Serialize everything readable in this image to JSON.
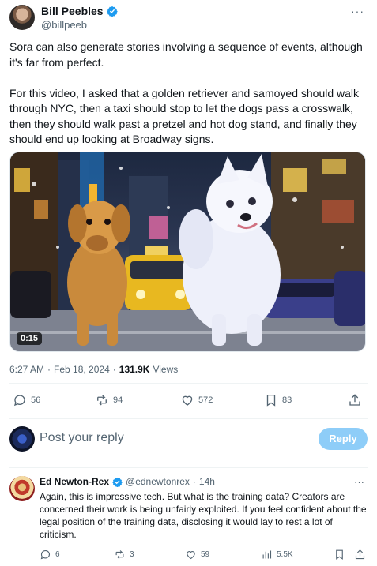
{
  "post": {
    "author": {
      "display_name": "Bill Peebles",
      "handle": "@billpeeb",
      "verified_icon": "verified-badge-icon"
    },
    "more_icon": "more-icon",
    "paragraphs": [
      "Sora can also generate stories involving a sequence of events, although it's far from perfect.",
      "For this video, I asked that a golden retriever and samoyed should walk through NYC, then a taxi should stop to let the dogs pass a crosswalk, then they should walk past a pretzel and hot dog stand, and finally they should end up looking at Broadway signs."
    ],
    "video": {
      "duration": "0:15"
    },
    "meta": {
      "time": "6:27 AM",
      "separator": "·",
      "date": "Feb 18, 2024",
      "views_count": "131.9K",
      "views_label": "Views"
    },
    "actions": {
      "replies": "56",
      "reposts": "94",
      "likes": "572",
      "bookmarks": "83"
    }
  },
  "reply_composer": {
    "placeholder": "Post your reply",
    "button_label": "Reply"
  },
  "reply": {
    "display_name": "Ed Newton-Rex",
    "handle": "@ednewtonrex",
    "separator": "·",
    "time": "14h",
    "text": "Again, this is impressive tech. But what is the training data? Creators are concerned their work is being unfairly exploited. If you feel confident about the legal position of the training data, disclosing it would lay to rest a lot of criticism.",
    "actions": {
      "replies": "6",
      "reposts": "3",
      "likes": "59",
      "views": "5.5K"
    }
  },
  "colors": {
    "accent": "#1d9bf0",
    "reply_button": "#8ecdf8",
    "muted_text": "#536471"
  }
}
